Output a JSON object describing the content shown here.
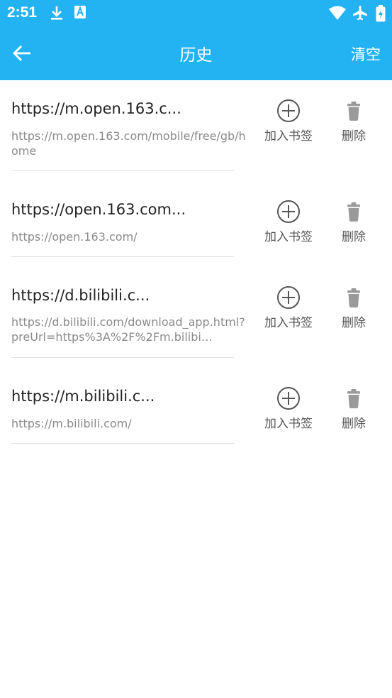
{
  "status_bar": {
    "time": "2:51",
    "left_icons": [
      "download-icon",
      "a-badge-icon"
    ],
    "right_icons": [
      "wifi-icon",
      "airplane-icon",
      "battery-icon"
    ]
  },
  "toolbar": {
    "title": "历史",
    "action_label": "清空",
    "background": "#23b3f3"
  },
  "history": [
    {
      "title": "https://m.open.163.c...",
      "url": "https://m.open.163.com/mobile/free/gb/home",
      "bookmark_label": "加入书签",
      "delete_label": "删除"
    },
    {
      "title": "https://open.163.com...",
      "url": "https://open.163.com/",
      "bookmark_label": "加入书签",
      "delete_label": "删除"
    },
    {
      "title": "https://d.bilibili.c...",
      "url": "https://d.bilibili.com/download_app.html?preUrl=https%3A%2F%2Fm.bilibi…",
      "bookmark_label": "加入书签",
      "delete_label": "删除"
    },
    {
      "title": "https://m.bilibili.c...",
      "url": "https://m.bilibili.com/",
      "bookmark_label": "加入书签",
      "delete_label": "删除"
    }
  ]
}
